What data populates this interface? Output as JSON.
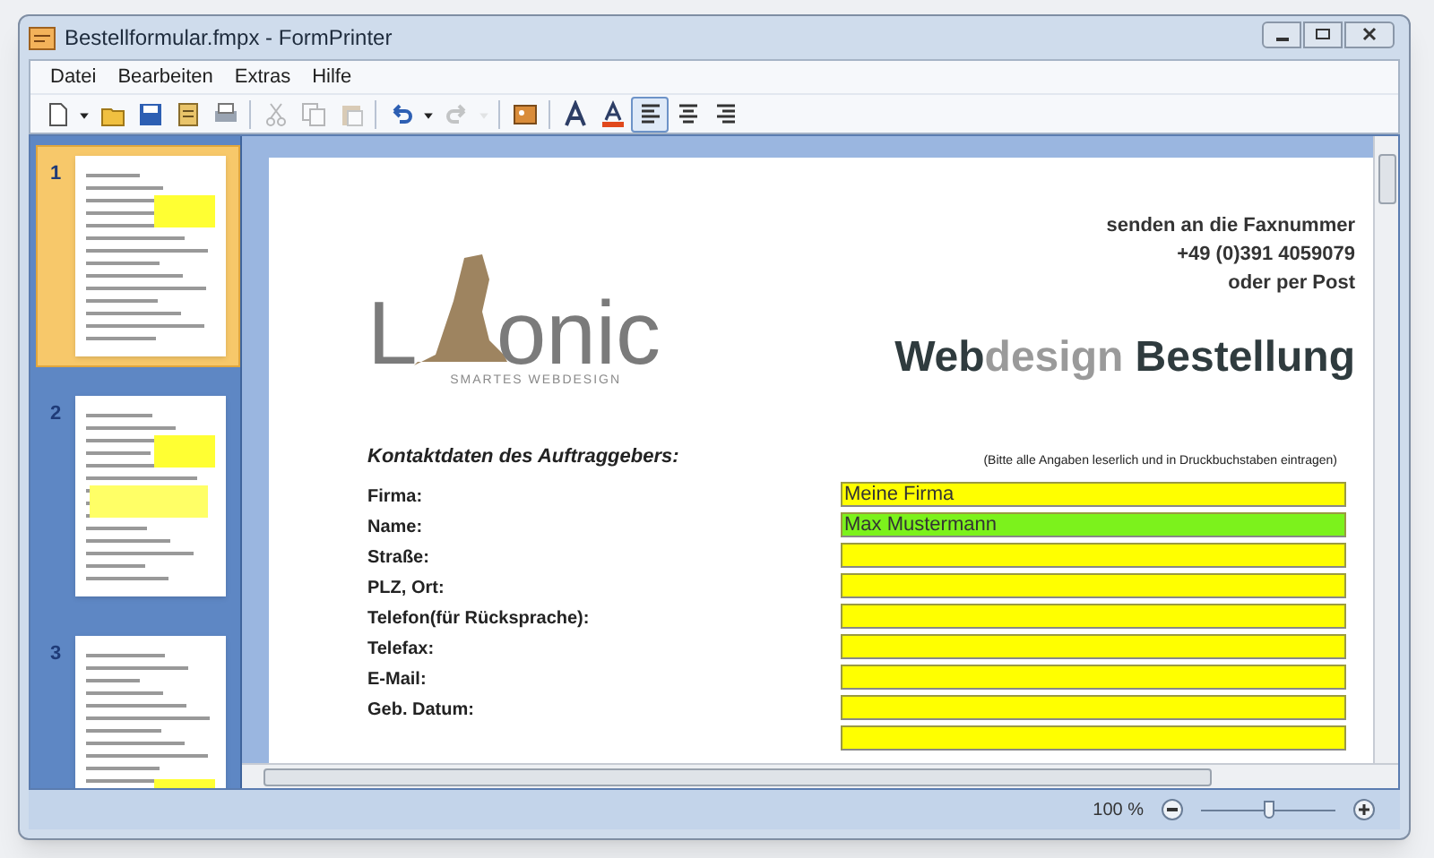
{
  "window": {
    "title": "Bestellformular.fmpx - FormPrinter"
  },
  "menu": [
    "Datei",
    "Bearbeiten",
    "Extras",
    "Hilfe"
  ],
  "toolbar": [
    {
      "kind": "new",
      "disabled": false
    },
    {
      "kind": "dropdown",
      "disabled": false
    },
    {
      "kind": "open",
      "disabled": false
    },
    {
      "kind": "save",
      "disabled": false
    },
    {
      "kind": "export",
      "disabled": false
    },
    {
      "kind": "print",
      "disabled": false
    },
    {
      "kind": "separator"
    },
    {
      "kind": "cut",
      "disabled": true
    },
    {
      "kind": "copy",
      "disabled": true
    },
    {
      "kind": "paste",
      "disabled": true
    },
    {
      "kind": "separator"
    },
    {
      "kind": "undo",
      "disabled": false
    },
    {
      "kind": "dropdown",
      "disabled": false
    },
    {
      "kind": "redo",
      "disabled": true
    },
    {
      "kind": "dropdown",
      "disabled": true
    },
    {
      "kind": "separator"
    },
    {
      "kind": "image",
      "disabled": false
    },
    {
      "kind": "separator"
    },
    {
      "kind": "font",
      "disabled": false
    },
    {
      "kind": "font-color",
      "disabled": false
    },
    {
      "kind": "align-left",
      "selected": true
    },
    {
      "kind": "align-center",
      "selected": false
    },
    {
      "kind": "align-right",
      "selected": false
    }
  ],
  "pages": [
    {
      "number": "1",
      "selected": true
    },
    {
      "number": "2",
      "selected": false
    },
    {
      "number": "3",
      "selected": false
    }
  ],
  "document": {
    "logo": {
      "letter": "L",
      "rest": "onic",
      "tagline": "SMARTES WEBDESIGN"
    },
    "fax_note": [
      "senden an die Faxnummer",
      "+49 (0)391 4059079",
      "oder per Post"
    ],
    "heading": [
      {
        "text": "Web",
        "kind": "dark"
      },
      {
        "text": "design",
        "kind": "light"
      },
      {
        "text": " Bestellung",
        "kind": "dark"
      }
    ],
    "section_title": "Kontaktdaten des Auftraggebers:",
    "hint": "(Bitte alle Angaben leserlich und in Druckbuchstaben eintragen)",
    "rows": [
      {
        "label": "Firma:",
        "value": "Meine Firma",
        "selected": false
      },
      {
        "label": "Name:",
        "value": "Max Mustermann",
        "selected": true
      },
      {
        "label": "Straße:",
        "selected": false
      },
      {
        "label": "PLZ, Ort:",
        "selected": false
      },
      {
        "label": "Telefon(für Rücksprache):",
        "selected": false
      },
      {
        "label": "Telefax:",
        "selected": false
      },
      {
        "label": "E-Mail:",
        "selected": false
      },
      {
        "label": "Geb. Datum:",
        "selected": false
      },
      {
        "selected": false
      }
    ]
  },
  "status_bar": {
    "zoom": "100 %",
    "zoom_slider": {
      "level": 0.5
    }
  }
}
